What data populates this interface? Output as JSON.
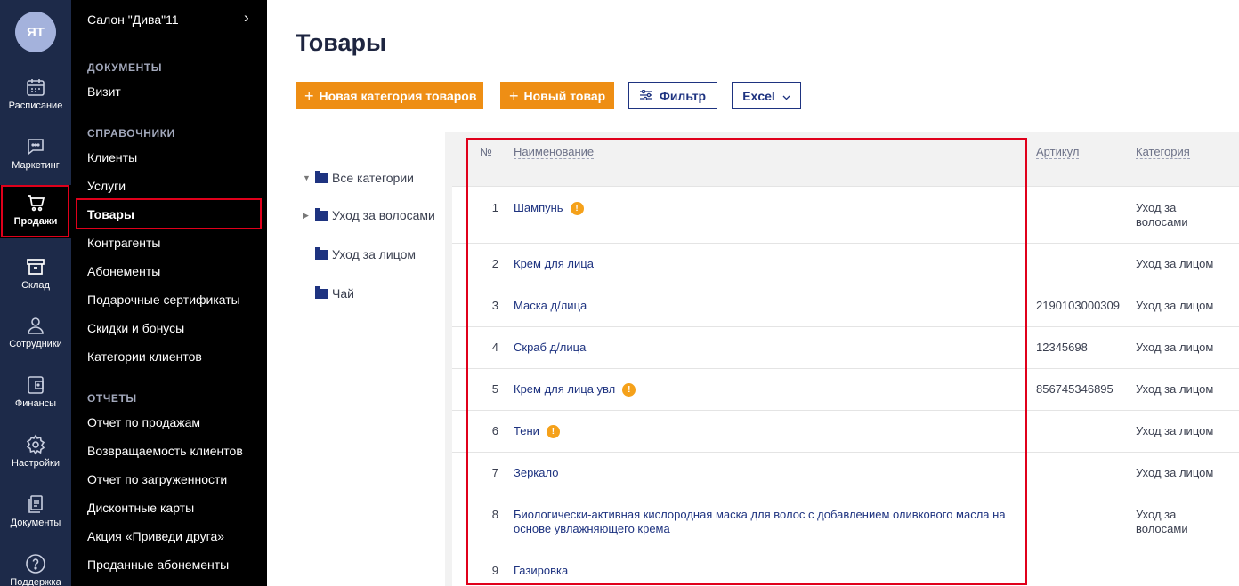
{
  "rail": {
    "avatar_initials": "ЯТ",
    "items": [
      {
        "label": "Расписание",
        "icon": "calendar-icon"
      },
      {
        "label": "Маркетинг",
        "icon": "chat-icon"
      },
      {
        "label": "Продажи",
        "icon": "cart-icon"
      },
      {
        "label": "Склад",
        "icon": "archive-icon"
      },
      {
        "label": "Сотрудники",
        "icon": "user-icon"
      },
      {
        "label": "Финансы",
        "icon": "wallet-icon"
      },
      {
        "label": "Настройки",
        "icon": "gear-icon"
      },
      {
        "label": "Документы",
        "icon": "documents-icon"
      },
      {
        "label": "Поддержка",
        "icon": "help-icon"
      }
    ]
  },
  "menu": {
    "salon": "Салон \"Дива\"11",
    "sections": {
      "documents": "ДОКУМЕНТЫ",
      "references": "СПРАВОЧНИКИ",
      "reports": "ОТЧЕТЫ"
    },
    "items": [
      "Визит",
      "Клиенты",
      "Услуги",
      "Товары",
      "Контрагенты",
      "Абонементы",
      "Подарочные сертификаты",
      "Скидки и бонусы",
      "Категории клиентов",
      "Отчет по продажам",
      "Возвращаемость клиентов",
      "Отчет по загруженности",
      "Дисконтные карты",
      "Акция «Приведи друга»",
      "Проданные абонементы"
    ]
  },
  "page": {
    "title": "Товары",
    "buttons": {
      "new_category": "Новая категория товаров",
      "new_product": "Новый товар",
      "filter": "Фильтр",
      "excel": "Excel"
    }
  },
  "tree": [
    "Все категории",
    "Уход за волосами",
    "Уход за лицом",
    "Чай"
  ],
  "table": {
    "headers": {
      "num": "№",
      "name": "Наименование",
      "sku": "Артикул",
      "category": "Категория"
    },
    "rows": [
      {
        "num": "1",
        "name": "Шампунь",
        "warn": true,
        "sku": "",
        "category": "Уход за волосами"
      },
      {
        "num": "2",
        "name": "Крем для лица",
        "warn": false,
        "sku": "",
        "category": "Уход за лицом"
      },
      {
        "num": "3",
        "name": "Маска д/лица",
        "warn": false,
        "sku": "2190103000309",
        "category": "Уход за лицом"
      },
      {
        "num": "4",
        "name": "Скраб д/лица",
        "warn": false,
        "sku": "12345698",
        "category": "Уход за лицом"
      },
      {
        "num": "5",
        "name": "Крем для лица увл",
        "warn": true,
        "sku": "856745346895",
        "category": "Уход за лицом"
      },
      {
        "num": "6",
        "name": "Тени",
        "warn": true,
        "sku": "",
        "category": "Уход за лицом"
      },
      {
        "num": "7",
        "name": "Зеркало",
        "warn": false,
        "sku": "",
        "category": "Уход за лицом"
      },
      {
        "num": "8",
        "name": "Биологически-активная кислородная маска для волос с добавлением оливкового масла на основе увлажняющего крема",
        "warn": false,
        "sku": "",
        "category": "Уход за волосами"
      },
      {
        "num": "9",
        "name": "Газировка",
        "warn": false,
        "sku": "",
        "category": ""
      }
    ]
  }
}
